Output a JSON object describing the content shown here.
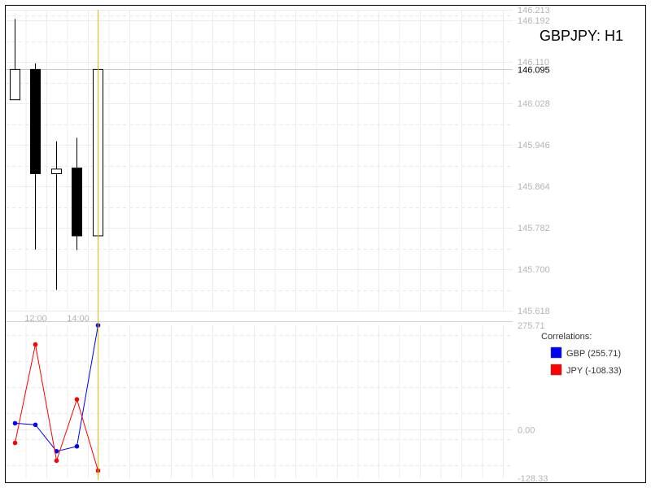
{
  "chart_title": "GBPJPY: H1",
  "chart_data": [
    {
      "type": "candlestick",
      "title": "GBPJPY: H1",
      "price_axis_ticks": [
        "146.213",
        "146.192",
        "146.110",
        "146.028",
        "145.946",
        "145.864",
        "145.782",
        "145.700",
        "145.618"
      ],
      "price_tick_values": [
        146.213,
        146.192,
        146.11,
        146.028,
        145.946,
        145.864,
        145.782,
        145.7,
        145.618
      ],
      "current_price_label": "146.095",
      "current_price": 146.095,
      "ylim": [
        145.618,
        146.213
      ],
      "time_axis_ticks": [
        "12:00",
        "14:00"
      ],
      "grid": true,
      "candles": [
        {
          "open": 146.035,
          "high": 146.195,
          "low": 146.035,
          "close": 146.095
        },
        {
          "open": 146.095,
          "high": 146.107,
          "low": 145.739,
          "close": 145.889
        },
        {
          "open": 145.889,
          "high": 145.953,
          "low": 145.659,
          "close": 145.898
        },
        {
          "open": 145.9,
          "high": 145.96,
          "low": 145.738,
          "close": 145.766
        },
        {
          "open": 145.766,
          "high": 146.095,
          "low": 145.636,
          "close": 146.095
        }
      ]
    },
    {
      "type": "line",
      "legend_title": "Correlations:",
      "value_axis_ticks": [
        "275.71",
        "0.00",
        "-128.33"
      ],
      "value_tick_values": [
        275.71,
        0,
        -128.33
      ],
      "ylim": [
        -128.33,
        275.71
      ],
      "x": [
        0,
        1,
        2,
        3,
        4
      ],
      "series": [
        {
          "name": "GBP (255.71)",
          "color": "#0000ff",
          "values": [
            17,
            13,
            -57,
            -44,
            275.71
          ]
        },
        {
          "name": "JPY (-108.33)",
          "color": "#ff0000",
          "values": [
            -35,
            225,
            -82,
            80,
            -108.33
          ]
        }
      ]
    }
  ],
  "colors": {
    "bull_fill": "#ffffff",
    "bear_fill": "#000000",
    "candle_stroke": "#000000",
    "cursor": "#e6b800"
  }
}
